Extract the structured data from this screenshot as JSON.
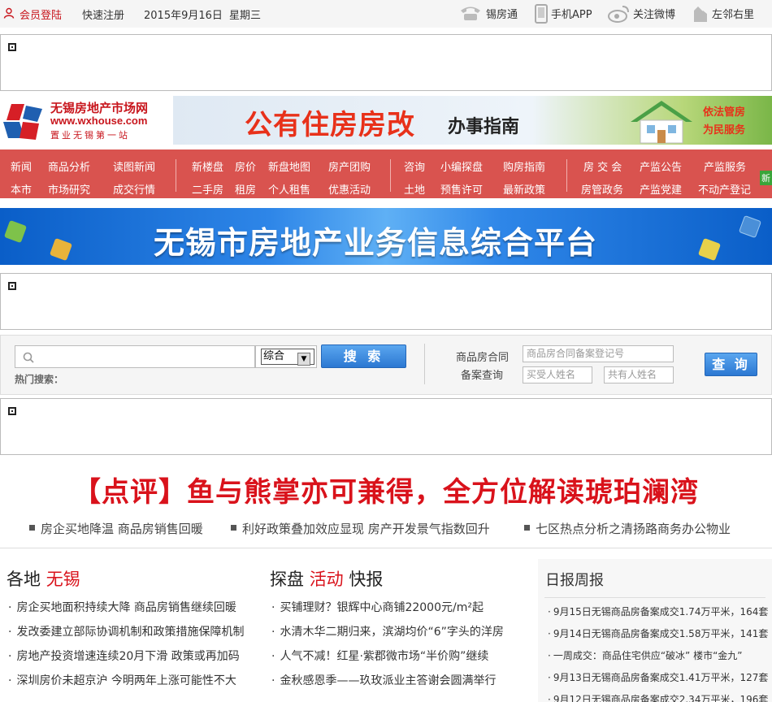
{
  "topbar": {
    "login": "会员登陆",
    "register": "快速注册",
    "date": "2015年9月16日",
    "weekday": "星期三",
    "links": [
      "锡房通",
      "手机APP",
      "关注微博",
      "左邻右里"
    ]
  },
  "logo": {
    "name": "无锡房地产市场网",
    "url": "www.wxhouse.com",
    "slogan": "置业无锡第一站"
  },
  "banner_top": {
    "main": "公有住房房改",
    "sub": "办事指南",
    "side1": "依法管房",
    "side2": "为民服务"
  },
  "nav": {
    "row1": [
      "新闻",
      "商品分析",
      "读图新闻",
      "新楼盘",
      "房价",
      "新盘地图",
      "房产团购",
      "咨询",
      "小编探盘",
      "购房指南",
      "房 交 会",
      "产监公告",
      "产监服务"
    ],
    "row2": [
      "本市",
      "市场研究",
      "成交行情",
      "二手房",
      "租房",
      "个人租售",
      "优惠活动",
      "土地",
      "预售许可",
      "最新政策",
      "房管政务",
      "产监党建",
      "不动产登记"
    ],
    "badge": "新"
  },
  "banner_mid": {
    "title": "无锡市房地产业务信息综合平台"
  },
  "search": {
    "type_value": "综合",
    "button": "搜 索",
    "hot_label": "热门搜索：",
    "query_label1": "商品房合同",
    "query_label2": "备案查询",
    "contract_placeholder": "商品房合同备案登记号",
    "buyer_placeholder": "买受人姓名",
    "co_owner_placeholder": "共有人姓名",
    "query_button": "查 询"
  },
  "headline": {
    "title": "【点评】鱼与熊掌亦可兼得，全方位解读琥珀澜湾",
    "subs": [
      "房企买地降温 商品房销售回暖",
      "利好政策叠加效应显现 房产开发景气指数回升",
      "七区热点分析之清扬路商务办公物业"
    ]
  },
  "col1": {
    "title_a": "各地",
    "title_b": "无锡",
    "items": [
      "房企买地面积持续大降 商品房销售继续回暖",
      "发改委建立部际协调机制和政策措施保障机制",
      "房地产投资增速连续20月下滑 政策或再加码",
      "深圳房价未超京沪 今明两年上涨可能性不大"
    ]
  },
  "col2": {
    "title_a": "探盘",
    "title_b": "活动",
    "title_c": "快报",
    "items": [
      "买铺理财？银辉中心商铺22000元/m²起",
      "水清木华二期归来，滨湖均价“6”字头的洋房",
      "人气不减！红星·紫郡微市场“半价购”继续",
      "金秋感恩季——玖玫派业主答谢会圆满举行"
    ]
  },
  "report": {
    "title": "日报周报",
    "items": [
      "9月15日无锡商品房备案成交1.74万平米，164套",
      "9月14日无锡商品房备案成交1.58万平米，141套",
      "一周成交：商品住宅供应“破冰” 楼市“金九”",
      "9月13日无锡商品房备案成交1.41万平米，127套",
      "9月12日无锡商品房备案成交2.34万平米，196套"
    ]
  },
  "colors": {
    "accent_red": "#d9121b",
    "nav_bg": "#d9534f",
    "button_blue": "#2c78d2"
  }
}
